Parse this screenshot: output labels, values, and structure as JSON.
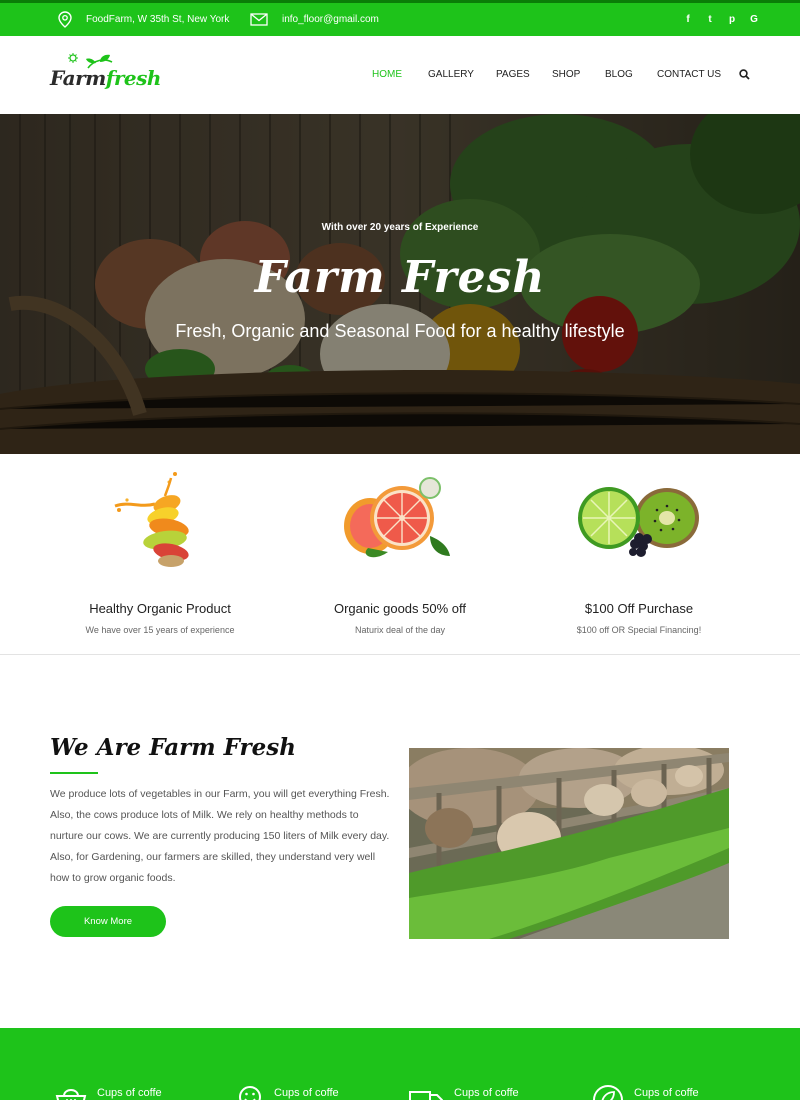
{
  "topbar": {
    "address": "FoodFarm, W 35th St, New York",
    "email": "info_floor@gmail.com",
    "social": [
      {
        "icon": "facebook-icon",
        "glyph": "f"
      },
      {
        "icon": "twitter-icon",
        "glyph": "t"
      },
      {
        "icon": "pinterest-icon",
        "glyph": "p"
      },
      {
        "icon": "google-icon",
        "glyph": "G"
      }
    ]
  },
  "header": {
    "logo_part1": "Farm",
    "logo_part2": "fresh",
    "nav": [
      {
        "label": "HOME",
        "active": true
      },
      {
        "label": "GALLERY",
        "active": false
      },
      {
        "label": "PAGES",
        "active": false
      },
      {
        "label": "SHOP",
        "active": false
      },
      {
        "label": "BLOG",
        "active": false
      },
      {
        "label": "CONTACT US",
        "active": false
      }
    ]
  },
  "hero": {
    "kicker": "With over 20 years of Experience",
    "title": "Farm Fresh",
    "subtitle": "Fresh, Organic and Seasonal Food for a healthy lifestyle"
  },
  "features": [
    {
      "title": "Healthy Organic Product",
      "description": "We have over 15 years of experience",
      "image": "fruit-splash-image"
    },
    {
      "title": "Organic goods 50% off",
      "description": "Naturix deal of the day",
      "image": "grapefruit-image"
    },
    {
      "title": "$100 Off Purchase",
      "description": "$100 off OR Special Financing!",
      "image": "lime-kiwi-image"
    }
  ],
  "about": {
    "heading": "We Are Farm Fresh",
    "body": "We produce lots of vegetables in our Farm, you will get everything Fresh. Also, the cows produce lots of Milk. We rely on healthy methods to nurture our cows. We are currently producing 150 liters of Milk every day. Also, for Gardening, our farmers are skilled, they understand very well how to grow organic foods.",
    "button": "Know More",
    "image": "cows-eating-grass-photo"
  },
  "stats": [
    {
      "label": "Cups of coffe",
      "icon": "basket-icon"
    },
    {
      "label": "Cups of coffe",
      "icon": "smiley-icon"
    },
    {
      "label": "Cups of coffe",
      "icon": "truck-icon"
    },
    {
      "label": "Cups of coffe",
      "icon": "leaf-circle-icon"
    }
  ],
  "colors": {
    "accent": "#1ec31a",
    "text_dark": "#222222",
    "text_muted": "#666666"
  }
}
